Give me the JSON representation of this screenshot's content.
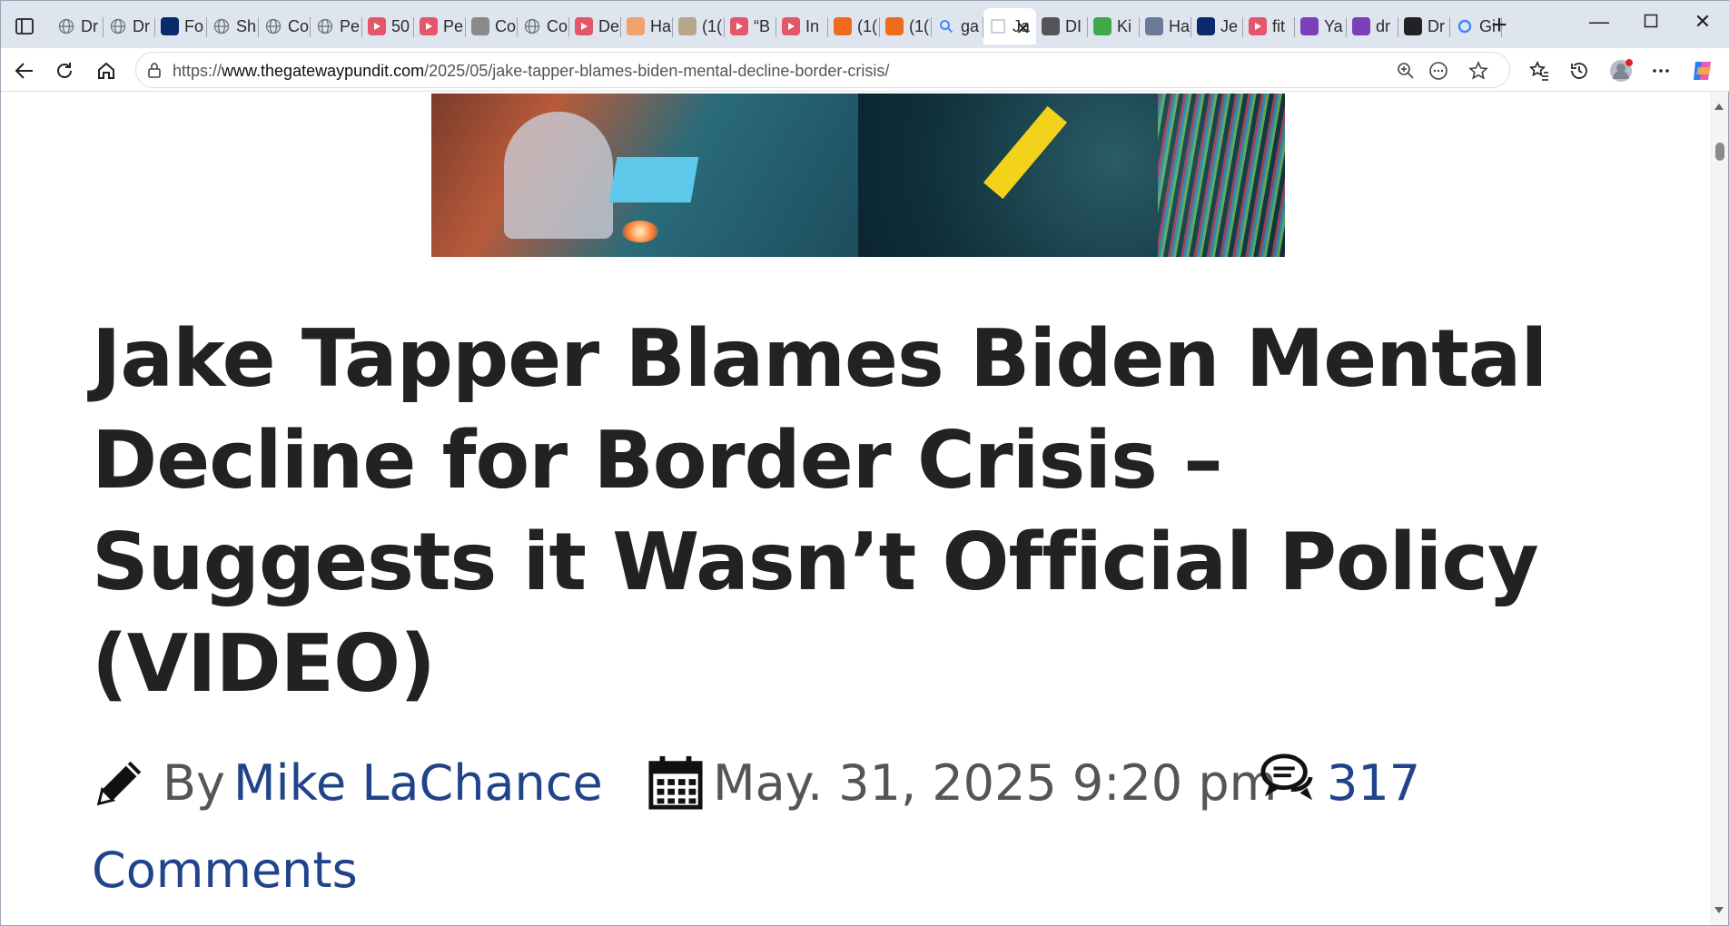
{
  "browser": {
    "tabs": [
      {
        "label": "Dr",
        "icon": "globe-icon",
        "color": "#6b7280"
      },
      {
        "label": "Dr",
        "icon": "globe-icon",
        "color": "#6b7280"
      },
      {
        "label": "Fo",
        "icon": "foxnews-icon",
        "color": "#0b2a6b"
      },
      {
        "label": "Sh",
        "icon": "globe-icon",
        "color": "#6b7280"
      },
      {
        "label": "Co",
        "icon": "globe-icon",
        "color": "#6b7280"
      },
      {
        "label": "Pe",
        "icon": "globe-icon",
        "color": "#6b7280"
      },
      {
        "label": "50",
        "icon": "youtube-icon",
        "color": "#e5566a"
      },
      {
        "label": "Pe",
        "icon": "youtube-icon",
        "color": "#e5566a"
      },
      {
        "label": "Co",
        "icon": "seal-icon",
        "color": "#8a8a8a"
      },
      {
        "label": "Co",
        "icon": "globe-icon",
        "color": "#6b7280"
      },
      {
        "label": "De",
        "icon": "youtube-icon",
        "color": "#e5566a"
      },
      {
        "label": "Ha",
        "icon": "bitcoin-icon",
        "color": "#f0a36b"
      },
      {
        "label": "(1(",
        "icon": "photo-icon",
        "color": "#b9a58a"
      },
      {
        "label": "“B",
        "icon": "youtube-icon",
        "color": "#e5566a"
      },
      {
        "label": "In",
        "icon": "youtube-icon",
        "color": "#e5566a"
      },
      {
        "label": "(1(",
        "icon": "bookmark-icon",
        "color": "#f06a1d"
      },
      {
        "label": "(1(",
        "icon": "bookmark-icon",
        "color": "#f06a1d"
      },
      {
        "label": "ga",
        "icon": "search-icon",
        "color": "#3b82f6"
      },
      {
        "label": "Ja",
        "icon": "gatewaypundit-icon",
        "color": "#ffffff",
        "active": true
      },
      {
        "label": "DI",
        "icon": "dr-icon",
        "color": "#555555"
      },
      {
        "label": "Ki",
        "icon": "green-icon",
        "color": "#3fa94a"
      },
      {
        "label": "Ha",
        "icon": "shield-icon",
        "color": "#6b7a99"
      },
      {
        "label": "Je",
        "icon": "jet-icon",
        "color": "#0b2a6b"
      },
      {
        "label": "fit",
        "icon": "youtube-icon",
        "color": "#e5566a"
      },
      {
        "label": "Ya",
        "icon": "yahoo-icon",
        "color": "#7b3fb9"
      },
      {
        "label": "dr",
        "icon": "yahoo-icon",
        "color": "#7b3fb9"
      },
      {
        "label": "Dr",
        "icon": "dr-icon",
        "color": "#222222"
      },
      {
        "label": "Gi",
        "icon": "google-icon",
        "color": "#4285f4"
      }
    ],
    "url_prefix": "https://",
    "url_host": "www.thegatewaypundit.com",
    "url_path": "/2025/05/jake-tapper-blames-biden-mental-decline-border-crisis/"
  },
  "article": {
    "headline": "Jake Tapper Blames Biden Mental Decline for Border Crisis – Suggests it Wasn’t Official Policy (VIDEO)",
    "by_label": "By",
    "author": "Mike LaChance",
    "date": "May. 31, 2025 9:20 pm",
    "comments_count": "317",
    "comments_label": "Comments"
  }
}
